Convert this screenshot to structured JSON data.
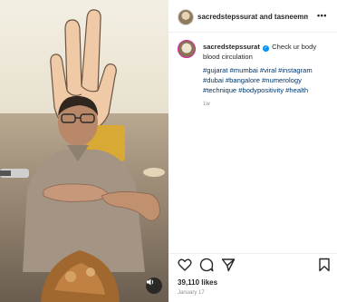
{
  "post": {
    "header_names": "sacredstepssurat and tasneemmor",
    "more_icon": "•••",
    "caption_user": "sacredstepssurat",
    "caption_text": "Check ur body blood circulation",
    "hashtags": "#gujarat #mumbai #viral #instagram #dubai #bangalore #numerology #technique #bodypositivity #health",
    "time_ago": "1w",
    "likes": "39,110 likes",
    "date": "January 17"
  },
  "icons": {
    "more": "more-options-icon",
    "verified": "verified-badge-icon",
    "like": "heart-icon",
    "comment": "comment-icon",
    "share": "share-icon",
    "save": "bookmark-icon",
    "mute": "volume-icon",
    "hand_sign": "three-finger-hand-icon"
  },
  "colors": {
    "hashtag": "#00376b",
    "verified": "#0095f6",
    "meta_gray": "#8e8e8e",
    "text": "#262626"
  }
}
